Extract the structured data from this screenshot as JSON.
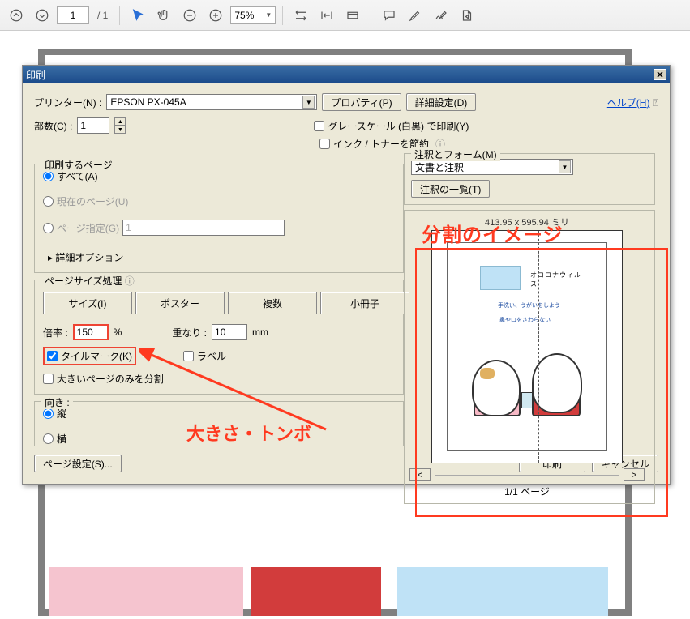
{
  "toolbar": {
    "page_current": "1",
    "page_total": "/ 1",
    "zoom": "75%"
  },
  "dialog": {
    "title": "印刷",
    "printer_label": "プリンター(N) :",
    "printer_value": "EPSON PX-045A",
    "properties_btn": "プロパティ(P)",
    "advanced_btn": "詳細設定(D)",
    "help_link": "ヘルプ(H)",
    "help_icon": "⍰",
    "copies_label": "部数(C) :",
    "copies_value": "1",
    "grayscale_label": "グレースケール (白黒) で印刷(Y)",
    "save_ink_label": "インク / トナーを節約",
    "info_icon": "ⓘ"
  },
  "pages": {
    "legend": "印刷するページ",
    "all": "すべて(A)",
    "current": "現在のページ(U)",
    "range": "ページ指定(G)",
    "range_value": "1",
    "more": "詳細オプション"
  },
  "sizing": {
    "legend": "ページサイズ処理",
    "btns": {
      "size": "サイズ(I)",
      "poster": "ポスター",
      "multi": "複数",
      "booklet": "小冊子"
    },
    "scale_label": "倍率 :",
    "scale_value": "150",
    "scale_unit": "%",
    "overlap_label": "重なり :",
    "overlap_value": "10",
    "overlap_unit": "mm",
    "tile_label": "タイルマーク(K)",
    "label_label": "ラベル",
    "large_only_label": "大きいページのみを分割"
  },
  "orient": {
    "legend": "向き :",
    "portrait": "縦",
    "landscape": "横"
  },
  "right": {
    "legend": "注釈とフォーム(M)",
    "combo_value": "文書と注釈",
    "summary_btn": "注釈の一覧(T)",
    "dim": "413.95 x 595.94 ミリ",
    "pagenav": "1/1 ページ",
    "prev": "<",
    "next": ">"
  },
  "preview_content": {
    "banner": "オコロナウィルス",
    "line1": "手洗い、うがいをしよう",
    "line2": "鼻や口をさわらない"
  },
  "footer": {
    "page_setup": "ページ設定(S)...",
    "print": "印刷",
    "cancel": "キャンセル"
  },
  "annotations": {
    "split": "分割のイメージ",
    "size_tombo": "大きさ・トンボ"
  }
}
